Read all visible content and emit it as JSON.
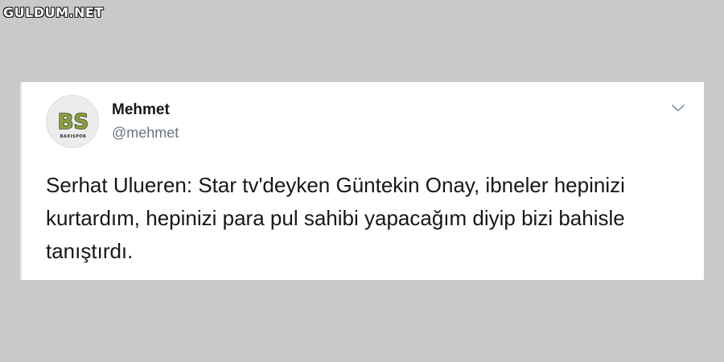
{
  "watermark": "GULDUM.NET",
  "tweet": {
    "display_name": "Mehmet",
    "handle": "@mehmet",
    "avatar": {
      "initials": "BS",
      "subtext": "BAXISPOR",
      "icon": "team-logo-icon"
    },
    "menu_icon": "chevron-down-icon",
    "text": "Serhat Ulueren: Star tv'deyken Güntekin Onay, ibneler hepinizi kurtardım, hepinizi para pul sahibi yapacağım diyip bizi bahisle tanıştırdı."
  },
  "colors": {
    "background": "#c9c9c9",
    "card": "#ffffff",
    "text_primary": "#14171a",
    "text_secondary": "#657786",
    "avatar_green": "#8aa13a",
    "avatar_dark": "#2b2b2b"
  }
}
